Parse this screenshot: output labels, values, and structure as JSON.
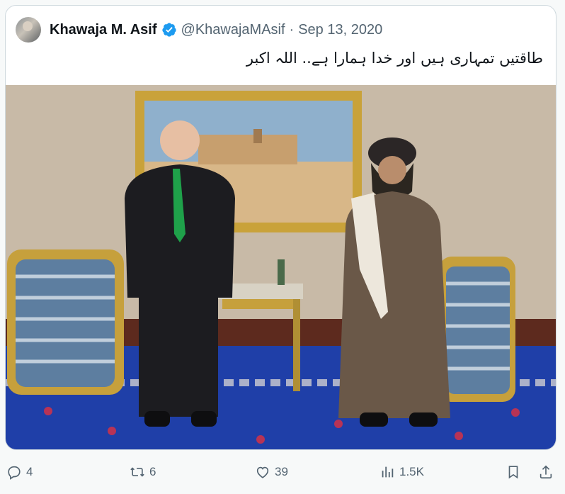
{
  "tweet": {
    "author_name": "Khawaja M. Asif",
    "handle": "@KhawajaMAsif",
    "separator": "·",
    "date": "Sep 13, 2020",
    "text": "طاقتیں تمہاری ہیں اور خدا ہمارا ہے.. اللہ اکبر",
    "verified": true,
    "accent_color": "#1d9bf0"
  },
  "actions": {
    "reply_count": "4",
    "retweet_count": "6",
    "like_count": "39",
    "views_count": "1.5K"
  },
  "icons": {
    "reply": "reply-icon",
    "retweet": "retweet-icon",
    "like": "heart-icon",
    "views": "views-icon",
    "bookmark": "bookmark-icon",
    "share": "share-icon"
  }
}
